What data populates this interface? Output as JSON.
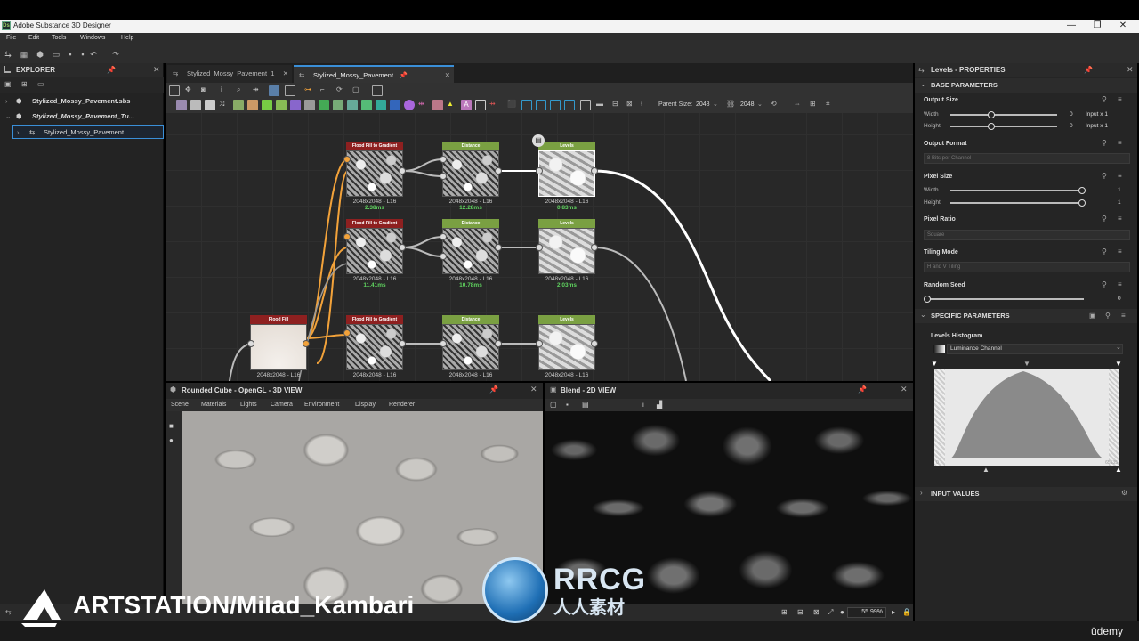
{
  "window": {
    "title": "Adobe Substance 3D Designer",
    "app_icon": "Ds",
    "controls": [
      "—",
      "❐",
      "✕"
    ]
  },
  "menu": [
    "File",
    "Edit",
    "Tools",
    "Windows",
    "Help"
  ],
  "explorer": {
    "title": "EXPLORER",
    "items": [
      {
        "label": "Stylized_Mossy_Pavement.sbs",
        "icon": "package-icon"
      },
      {
        "label": "Stylized_Mossy_Pavement_Tu...",
        "icon": "package-icon"
      },
      {
        "label": "Stylized_Mossy_Pavement",
        "icon": "graph-icon"
      }
    ]
  },
  "graph": {
    "tabs": [
      "Stylized_Mossy_Pavement_1",
      "Stylized_Mossy_Pavement"
    ],
    "parent_size_label": "Parent Size:",
    "parent_size_value": "2048",
    "size_value": "2048",
    "nodes": [
      {
        "title": "Flood Fill to Gradient",
        "res": "2048x2048 - L16",
        "ms": "2.38ms",
        "color": "#8e2020",
        "kind": "grad"
      },
      {
        "title": "Distance",
        "res": "2048x2048 - L16",
        "ms": "12.28ms",
        "color": "#7aa042",
        "kind": "grad"
      },
      {
        "title": "Levels",
        "res": "2048x2048 - L16",
        "ms": "0.83ms",
        "color": "#7aa042",
        "kind": "lv"
      },
      {
        "title": "Flood Fill to Gradient",
        "res": "2048x2048 - L16",
        "ms": "11.41ms",
        "color": "#8e2020",
        "kind": "grad"
      },
      {
        "title": "Distance",
        "res": "2048x2048 - L16",
        "ms": "10.78ms",
        "color": "#7aa042",
        "kind": "grad"
      },
      {
        "title": "Levels",
        "res": "2048x2048 - L16",
        "ms": "2.03ms",
        "color": "#7aa042",
        "kind": "lv"
      },
      {
        "title": "Flood Fill",
        "res": "2048x2048 - L16",
        "ms": "",
        "color": "#8e2020",
        "kind": "ff"
      },
      {
        "title": "Flood Fill to Gradient",
        "res": "2048x2048 - L16",
        "ms": "",
        "color": "#8e2020",
        "kind": "grad"
      },
      {
        "title": "Distance",
        "res": "2048x2048 - L16",
        "ms": "",
        "color": "#7aa042",
        "kind": "grad"
      },
      {
        "title": "Levels",
        "res": "2048x2048 - L16",
        "ms": "",
        "color": "#7aa042",
        "kind": "lv"
      }
    ]
  },
  "view3d": {
    "title": "Rounded Cube - OpenGL - 3D VIEW",
    "menu": [
      "Scene",
      "Materials",
      "Lights",
      "Camera",
      "Environment",
      "Display",
      "Renderer"
    ]
  },
  "view2d": {
    "title": "Blend - 2D VIEW",
    "zoom": "55.99%"
  },
  "properties": {
    "title": "Levels - PROPERTIES",
    "base_section": "BASE PARAMETERS",
    "output_size": "Output Size",
    "width": "Width",
    "height": "Height",
    "out_w_val": "0",
    "out_w_mode": "Input x 1",
    "out_h_val": "0",
    "out_h_mode": "Input x 1",
    "output_format": "Output Format",
    "output_format_value": "8 Bits per Channel",
    "pixel_size": "Pixel Size",
    "px_w_val": "1",
    "px_h_val": "1",
    "pixel_ratio": "Pixel Ratio",
    "pixel_ratio_value": "Square",
    "tiling_mode": "Tiling Mode",
    "tiling_mode_value": "H and V Tiling",
    "random_seed": "Random Seed",
    "random_seed_value": "0",
    "specific_section": "SPECIFIC PARAMETERS",
    "histogram_label": "Levels Histogram",
    "channel": "Luminance Channel",
    "hist_min": "0",
    "hist_max": "65535",
    "input_values": "INPUT VALUES"
  },
  "watermark": {
    "artstation": "ARTSTATION/Milad_Kambari",
    "rrcg": "RRCG",
    "rrcg_sub": "人人素材",
    "udemy": "ūdemy"
  }
}
